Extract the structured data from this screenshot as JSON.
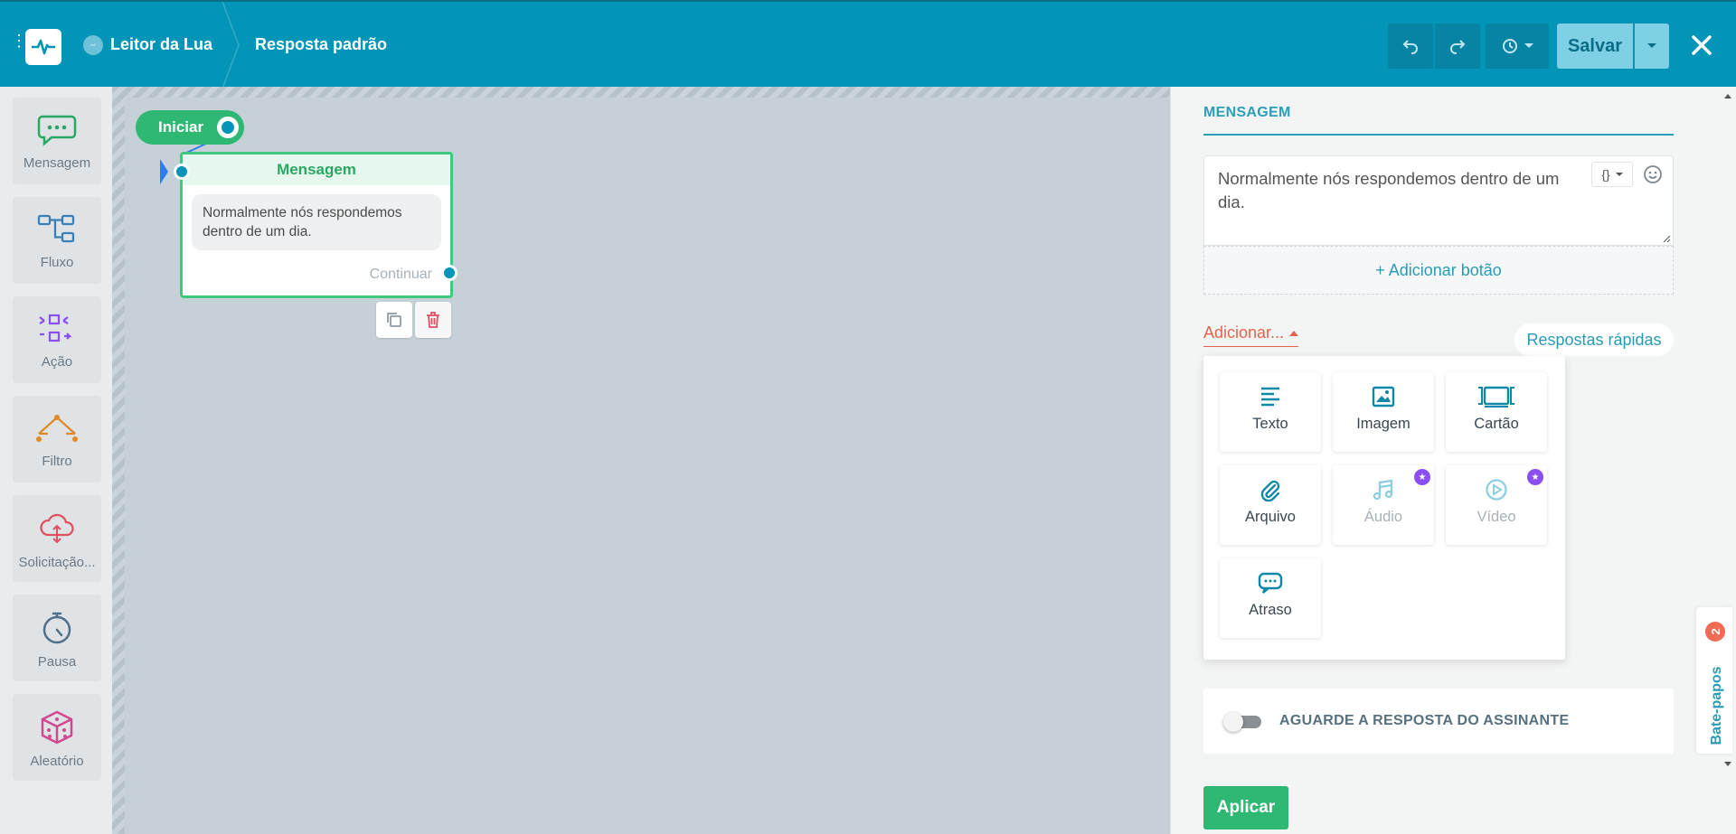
{
  "header": {
    "bot_name": "Leitor da Lua",
    "flow_name": "Resposta padrão",
    "save_label": "Salvar"
  },
  "sidebar": {
    "items": [
      {
        "label": "Mensagem",
        "icon": "chat-bubble-icon",
        "color": "#2aa863"
      },
      {
        "label": "Fluxo",
        "icon": "flow-icon",
        "color": "#3a7fb5"
      },
      {
        "label": "Ação",
        "icon": "action-icon",
        "color": "#8a4ff0"
      },
      {
        "label": "Filtro",
        "icon": "filter-icon",
        "color": "#e08a2a"
      },
      {
        "label": "Solicitação...",
        "icon": "cloud-request-icon",
        "color": "#e0525f"
      },
      {
        "label": "Pausa",
        "icon": "stopwatch-icon",
        "color": "#4f6f8a"
      },
      {
        "label": "Aleatório",
        "icon": "dice-icon",
        "color": "#d4478f"
      }
    ]
  },
  "canvas": {
    "start_label": "Iniciar",
    "message_node": {
      "title": "Mensagem",
      "text": "Normalmente nós respondemos dentro de um dia.",
      "continue_label": "Continuar"
    }
  },
  "panel": {
    "title": "MENSAGEM",
    "message_text": "Normalmente nós respondemos dentro de um dia.",
    "add_button_label": "+ Adicionar botão",
    "add_menu_label": "Adicionar...",
    "quick_replies_label": "Respostas rápidas",
    "add_options": [
      {
        "label": "Texto",
        "icon": "text-lines-icon",
        "pro": false
      },
      {
        "label": "Imagem",
        "icon": "image-icon",
        "pro": false
      },
      {
        "label": "Cartão",
        "icon": "card-carousel-icon",
        "pro": false
      },
      {
        "label": "Arquivo",
        "icon": "paperclip-icon",
        "pro": false
      },
      {
        "label": "Áudio",
        "icon": "music-note-icon",
        "pro": true
      },
      {
        "label": "Vídeo",
        "icon": "play-circle-icon",
        "pro": true
      },
      {
        "label": "Atraso",
        "icon": "typing-bubble-icon",
        "pro": false
      }
    ],
    "wait_label": "AGUARDE A RESPOSTA DO ASSINANTE",
    "wait_enabled": false,
    "apply_label": "Aplicar"
  },
  "chat_tab": {
    "label": "Bate-papos",
    "badge": "2"
  },
  "colors": {
    "header_bg": "#0295b8",
    "accent_green": "#2fb873",
    "accent_teal": "#2a9bb4",
    "accent_red": "#e3644c",
    "pro_purple": "#8a4ff0"
  }
}
